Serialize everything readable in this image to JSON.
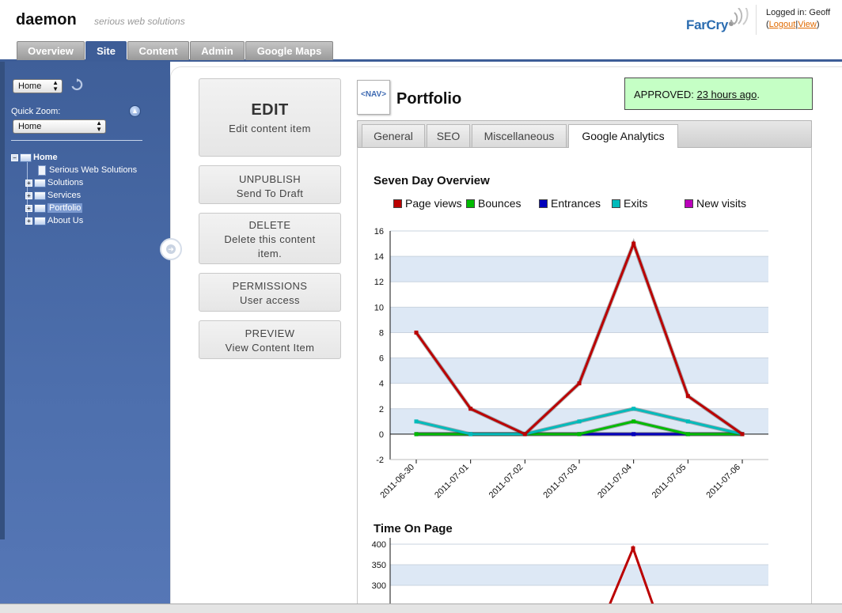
{
  "header": {
    "brand": "daemon",
    "tagline": "serious web solutions",
    "logo": "FarCry",
    "logged_in": "Logged in: Geoff",
    "logout": "Logout",
    "view": "View"
  },
  "nav": {
    "tabs": [
      {
        "label": "Overview",
        "active": false
      },
      {
        "label": "Site",
        "active": true
      },
      {
        "label": "Content",
        "active": false
      },
      {
        "label": "Admin",
        "active": false
      },
      {
        "label": "Google Maps",
        "active": false
      }
    ]
  },
  "sidebar": {
    "site_select": "Home",
    "quick_zoom_label": "Quick Zoom:",
    "quick_zoom_select": "Home",
    "tree": [
      {
        "label": "Home",
        "expander": "minus",
        "icon": "folder",
        "bold": true
      },
      {
        "label": "Serious Web Solutions",
        "icon": "document"
      },
      {
        "label": "Solutions",
        "expander": "plus",
        "icon": "folder"
      },
      {
        "label": "Services",
        "expander": "plus",
        "icon": "folder"
      },
      {
        "label": "Portfolio",
        "expander": "plus",
        "icon": "folder",
        "selected": true
      },
      {
        "label": "About Us",
        "expander": "plus",
        "icon": "folder"
      }
    ]
  },
  "actions": {
    "edit": {
      "title": "EDIT",
      "subtitle": "Edit content item"
    },
    "unpublish": {
      "title": "UNPUBLISH",
      "subtitle": "Send To Draft"
    },
    "delete": {
      "title": "DELETE",
      "subtitle": "Delete this content item."
    },
    "permissions": {
      "title": "PERMISSIONS",
      "subtitle": "User access"
    },
    "preview": {
      "title": "PREVIEW",
      "subtitle": "View Content Item"
    }
  },
  "content": {
    "type_icon": "<NAV>",
    "title": "Portfolio",
    "status_label": "APPROVED:",
    "status_time": "23 hours ago",
    "status_suffix": ".",
    "status_color": "#c5ffc5",
    "tabs": [
      {
        "label": "General",
        "active": false
      },
      {
        "label": "SEO",
        "active": false
      },
      {
        "label": "Miscellaneous",
        "active": false
      },
      {
        "label": "Google Analytics",
        "active": true
      }
    ]
  },
  "chart_data": [
    {
      "type": "line",
      "title": "Seven Day Overview",
      "x": [
        "2011-06-30",
        "2011-07-01",
        "2011-07-02",
        "2011-07-03",
        "2011-07-04",
        "2011-07-05",
        "2011-07-06"
      ],
      "ylim": [
        -2,
        16
      ],
      "yticks": [
        -2,
        0,
        2,
        4,
        6,
        8,
        10,
        12,
        14,
        16
      ],
      "grid": "alternating horizontal bands",
      "legend": "top",
      "series": [
        {
          "name": "Page views",
          "color": "#bb0000",
          "values": [
            8,
            2,
            0,
            4,
            15,
            3,
            0
          ]
        },
        {
          "name": "Bounces",
          "color": "#00bb00",
          "values": [
            0,
            0,
            0,
            0,
            1,
            0,
            0
          ]
        },
        {
          "name": "Entrances",
          "color": "#0000bb",
          "values": [
            0,
            0,
            0,
            0,
            0,
            0,
            0
          ]
        },
        {
          "name": "Exits",
          "color": "#00bbbb",
          "values": [
            1,
            0,
            0,
            1,
            2,
            1,
            0
          ]
        },
        {
          "name": "New visits",
          "color": "#bb00bb",
          "values": [
            0,
            0,
            0,
            0,
            0,
            0,
            0
          ]
        }
      ]
    },
    {
      "type": "line",
      "title": "Time On Page",
      "ylim": [
        250,
        400
      ],
      "yticks": [
        300,
        350,
        400
      ],
      "series": [
        {
          "color": "#bb0000",
          "values": [
            390
          ]
        }
      ]
    }
  ]
}
